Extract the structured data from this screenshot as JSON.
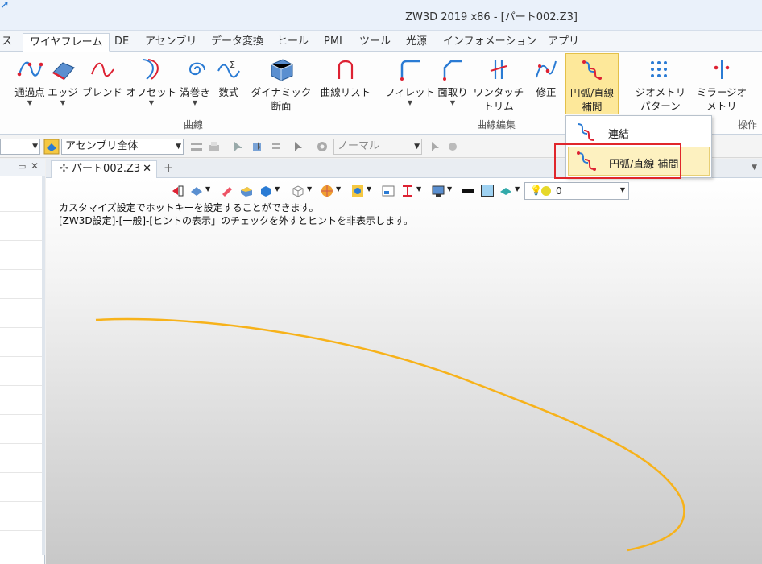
{
  "window": {
    "title": "ZW3D 2019  x86 - [パート002.Z3]"
  },
  "ribbon_tabs": [
    {
      "label": "ス"
    },
    {
      "label": "ワイヤフレーム",
      "active": true
    },
    {
      "label": "DE"
    },
    {
      "label": "アセンブリ"
    },
    {
      "label": "データ変換"
    },
    {
      "label": "ヒール"
    },
    {
      "label": "PMI"
    },
    {
      "label": "ツール"
    },
    {
      "label": "光源"
    },
    {
      "label": "インフォメーション"
    },
    {
      "label": "アプリ"
    }
  ],
  "ribbon": {
    "curve_buttons": [
      {
        "line1": "通過点",
        "line2": ""
      },
      {
        "line1": "エッジ",
        "line2": ""
      },
      {
        "line1": "ブレンド",
        "line2": ""
      },
      {
        "line1": "オフセット",
        "line2": ""
      },
      {
        "line1": "渦巻き",
        "line2": ""
      },
      {
        "line1": "数式",
        "line2": ""
      },
      {
        "line1": "ダイナミック",
        "line2": "断面"
      },
      {
        "line1": "曲線リスト",
        "line2": ""
      }
    ],
    "curve_group_label": "曲線",
    "edit_buttons": [
      {
        "line1": "フィレット",
        "line2": ""
      },
      {
        "line1": "面取り",
        "line2": ""
      },
      {
        "line1": "ワンタッチ",
        "line2": "トリム"
      },
      {
        "line1": "修正",
        "line2": ""
      },
      {
        "line1": "円弧/直線",
        "line2": "補間"
      }
    ],
    "edit_group_label": "曲線編集",
    "pattern_buttons": [
      {
        "line1": "ジオメトリ",
        "line2": "パターン"
      },
      {
        "line1": "ミラージオ",
        "line2": "メトリ"
      }
    ],
    "ops_group_label": "操作"
  },
  "toolbar": {
    "assembly_combo": "アセンブリ全体",
    "filter_combo": "ノーマル"
  },
  "doc_tab": {
    "label": "パート002.Z3"
  },
  "view_toolbar": {
    "layer_value": "0"
  },
  "hints": [
    "カスタマイズ設定でホットキーを設定することができます。",
    "[ZW3D設定]-[一般]-[ヒントの表示」のチェックを外すとヒントを非表示します。"
  ],
  "dropdown": {
    "items": [
      {
        "label": "連結"
      },
      {
        "label": "円弧/直線 補間"
      }
    ]
  },
  "colors": {
    "curve": "#f7b21a",
    "highlight": "#fde89a",
    "annotation": "#e0262b"
  }
}
